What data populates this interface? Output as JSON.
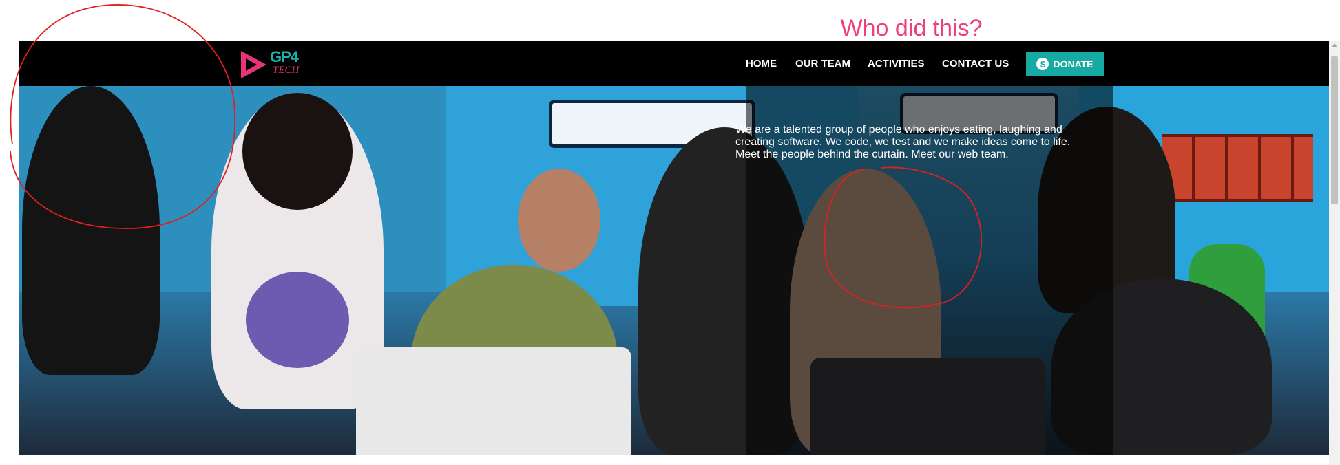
{
  "brand": {
    "logo_text": "GP4",
    "logo_sub": "TECH",
    "colors": {
      "teal": "#17b3ad",
      "pink": "#e5347a"
    }
  },
  "nav": {
    "items": [
      {
        "label": "HOME"
      },
      {
        "label": "OUR TEAM"
      },
      {
        "label": "ACTIVITIES"
      },
      {
        "label": "CONTACT US"
      }
    ],
    "donate": {
      "label": "DONATE",
      "icon": "dollar-icon"
    }
  },
  "hero": {
    "title": "Who did this?",
    "body": "We are a talented group of people who enjoys eating, laughing and creating software. We code, we test and we make ideas come to life. Meet the people behind the curtain. Meet our web team.",
    "title_color": "#ee3f79"
  },
  "annotations": {
    "color": "#e02020"
  }
}
